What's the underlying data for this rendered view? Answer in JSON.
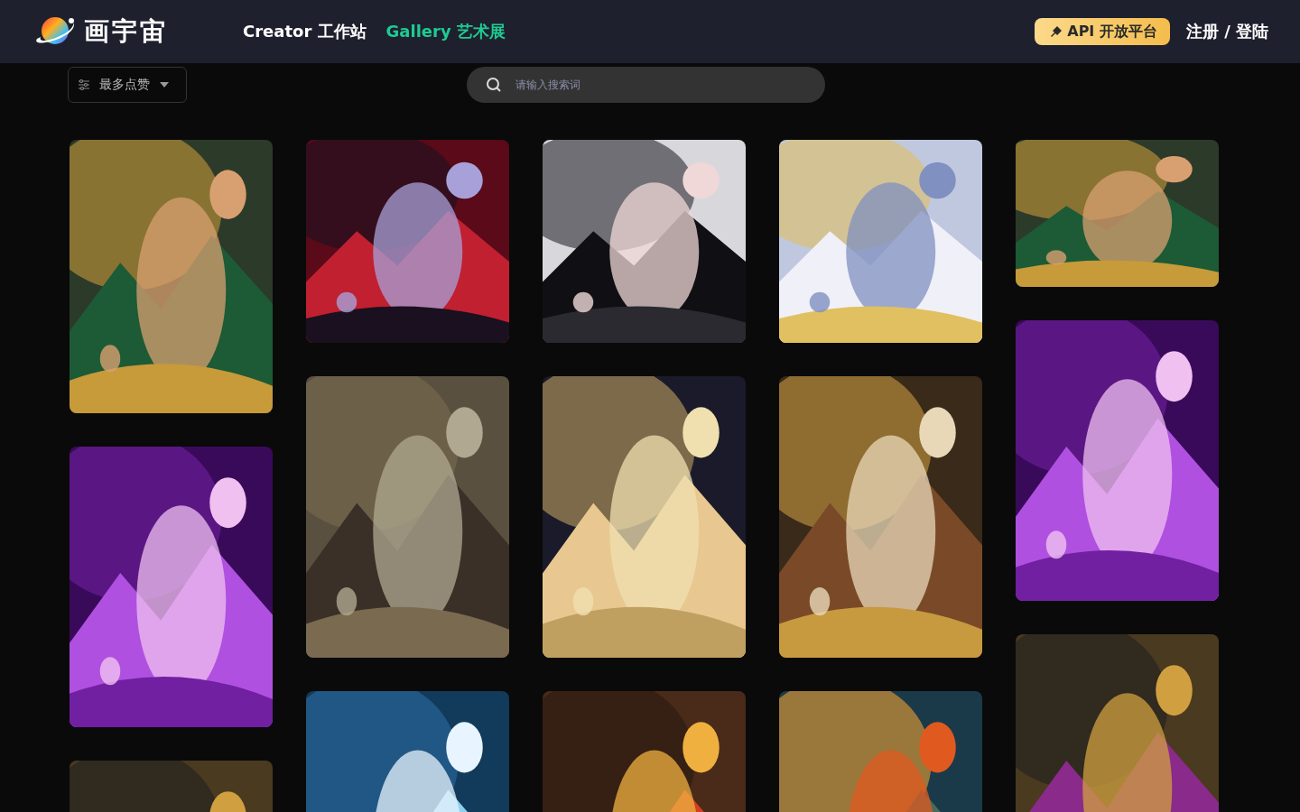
{
  "header": {
    "logo_text": "画宇宙",
    "nav": [
      {
        "label": "Creator 工作站",
        "selected": false
      },
      {
        "label": "Gallery 艺术展",
        "selected": true
      }
    ],
    "api_button": "API 开放平台",
    "login": "注册 / 登陆"
  },
  "toolbar": {
    "sort": "最多点赞",
    "search": {
      "placeholder": "请输入搜索词"
    }
  }
}
